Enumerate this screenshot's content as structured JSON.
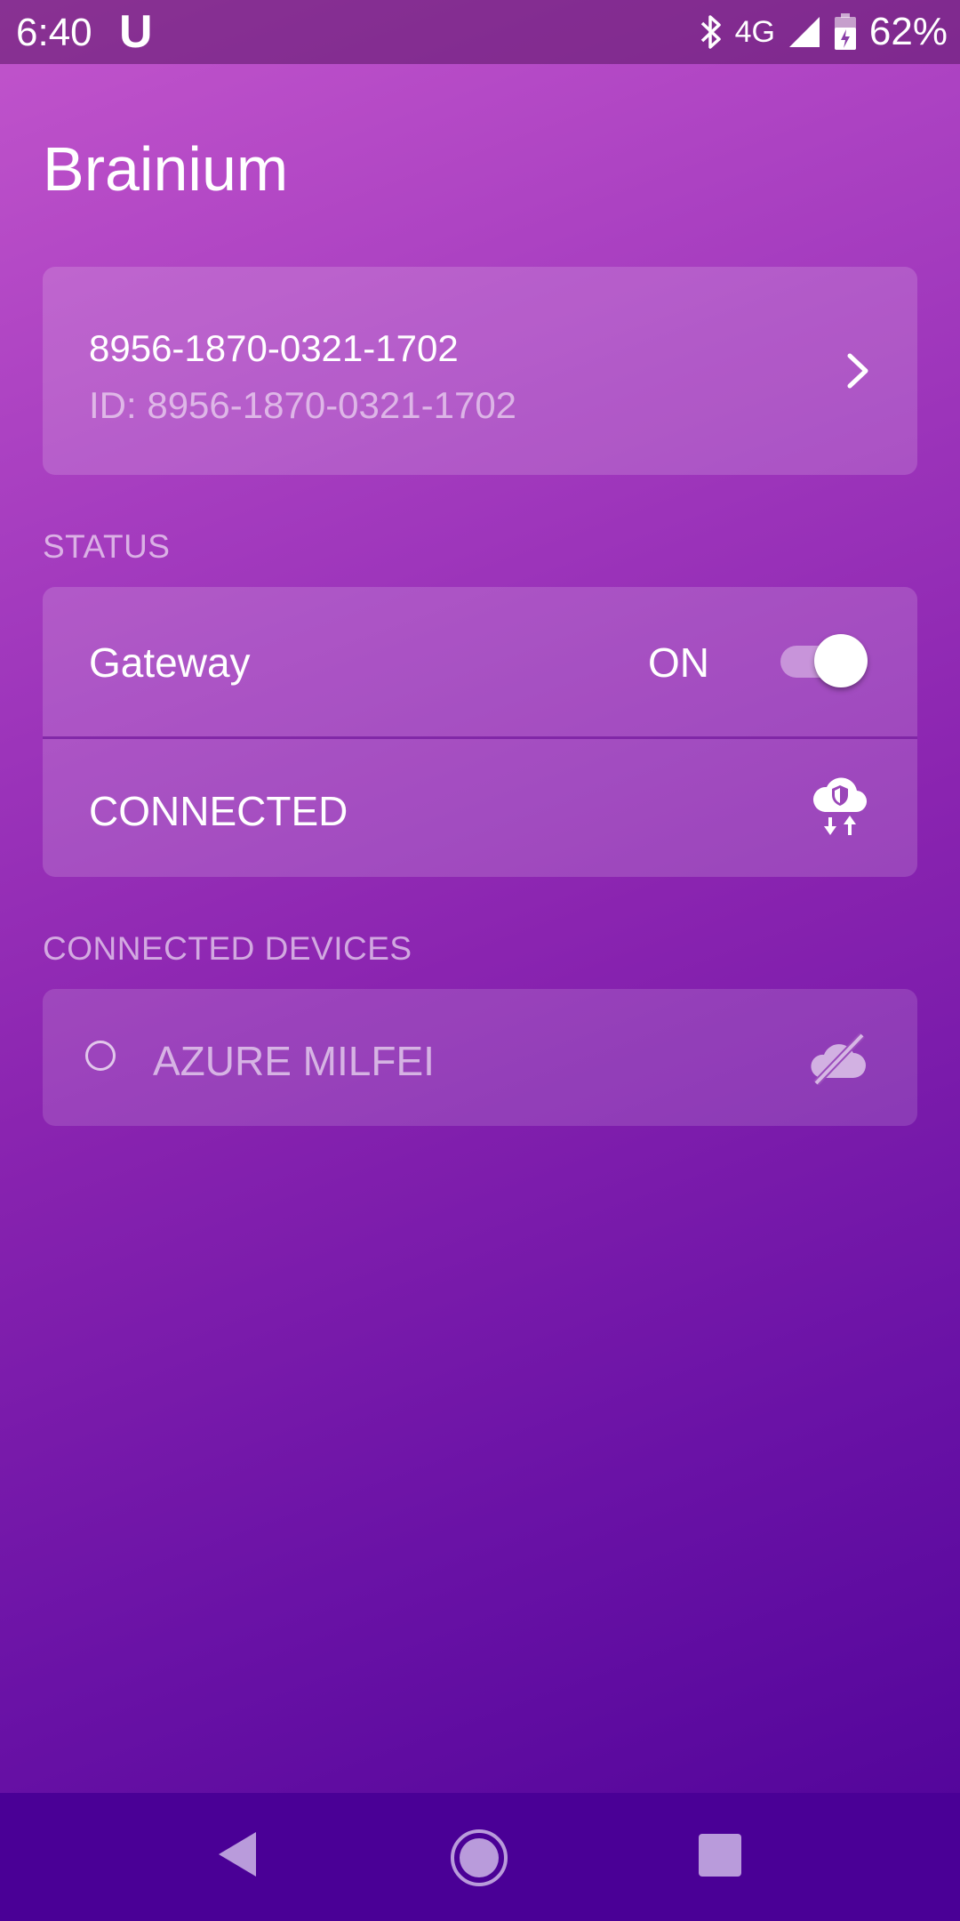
{
  "status_bar": {
    "time": "6:40",
    "carrier_icon_text": "U",
    "network": "4G",
    "battery": "62%"
  },
  "app": {
    "title": "Brainium"
  },
  "device": {
    "name": "8956-1870-0321-1702",
    "id_line": "ID: 8956-1870-0321-1702"
  },
  "status": {
    "section_label": "STATUS",
    "gateway_label": "Gateway",
    "gateway_state": "ON",
    "toggle_on": true,
    "connection_label": "CONNECTED"
  },
  "connected_devices": {
    "section_label": "CONNECTED DEVICES",
    "items": [
      {
        "label": "AZURE MILFEI",
        "icon": "cloud-off-icon"
      }
    ]
  },
  "colors": {
    "gradient_top": "#c255cc",
    "gradient_bottom": "#4e0298",
    "nav_bar": "#4a0096"
  }
}
